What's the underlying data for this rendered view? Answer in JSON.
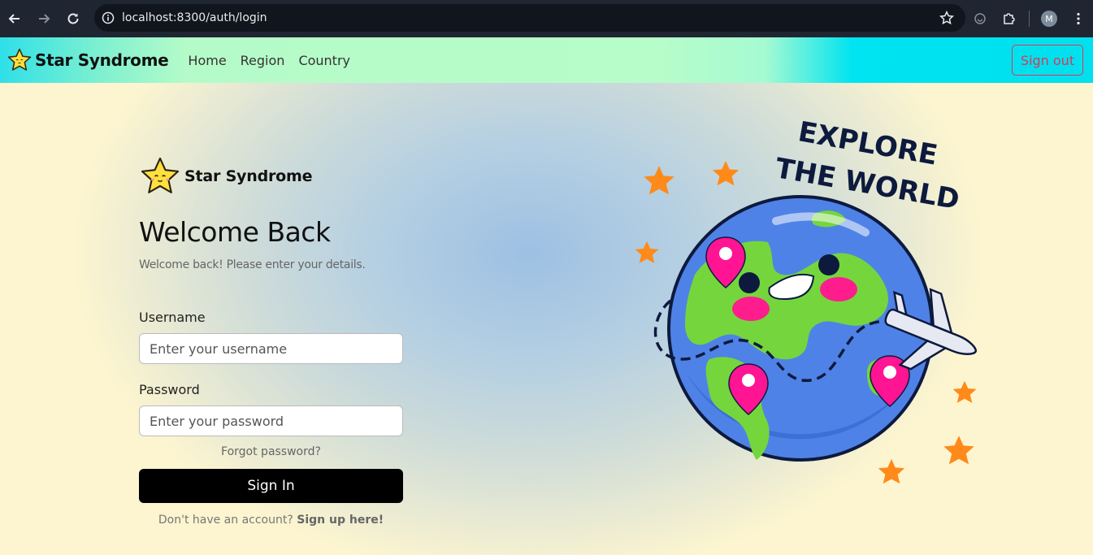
{
  "browser": {
    "url": "localhost:8300/auth/login",
    "profile_initial": "M"
  },
  "navbar": {
    "brand": "Star Syndrome",
    "links": [
      "Home",
      "Region",
      "Country"
    ],
    "signout_label": "Sign out"
  },
  "login": {
    "logo_text": "Star Syndrome",
    "heading": "Welcome Back",
    "subheading": "Welcome back! Please enter your details.",
    "username_label": "Username",
    "username_placeholder": "Enter your username",
    "password_label": "Password",
    "password_placeholder": "Enter your password",
    "forgot_label": "Forgot password?",
    "signin_label": "Sign In",
    "signup_prompt": "Don't have an account?",
    "signup_link": "Sign up here!"
  },
  "illustration": {
    "line1": "EXPLORE",
    "line2": "THE WORLD"
  },
  "colors": {
    "accent_signout": "#d63a5a",
    "signin_bg": "#000000",
    "ocean": "#4a7fe0",
    "land": "#6fd13c",
    "pin": "#ff1493",
    "star": "#ff8a1a"
  }
}
